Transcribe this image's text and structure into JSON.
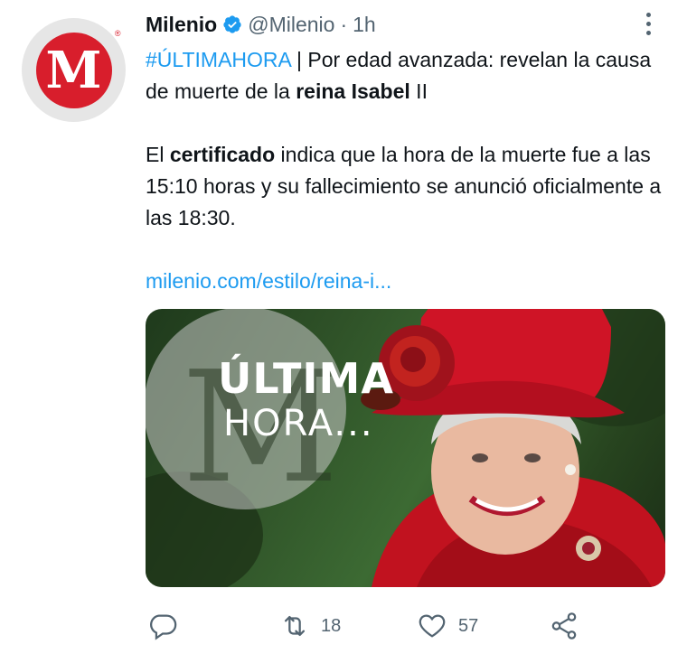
{
  "tweet": {
    "author_name": "Milenio",
    "handle": "@Milenio",
    "separator": "·",
    "time": "1h",
    "avatar_letter": "M",
    "avatar_reg": "®",
    "line1_hashtag": "#ÚLTIMAHORA",
    "line1_rest": " | Por edad avanzada: revelan la causa de muerte de la ",
    "line1_bold": "reina Isabel",
    "line1_end": " II",
    "para2_start": "El ",
    "para2_bold": "certificado",
    "para2_rest": " indica que la hora de la muerte fue a las 15:10 horas y su fallecimiento se anunció oficialmente a las 18:30.",
    "link": "milenio.com/estilo/reina-i..."
  },
  "media": {
    "overlay_title": "ÚLTIMA",
    "overlay_sub": "HORA..."
  },
  "actions": {
    "reply_count": "",
    "retweet_count": "18",
    "like_count": "57"
  },
  "colors": {
    "accent": "#1d9bf0",
    "brand_red": "#d81e2c",
    "secondary_text": "#536471"
  }
}
